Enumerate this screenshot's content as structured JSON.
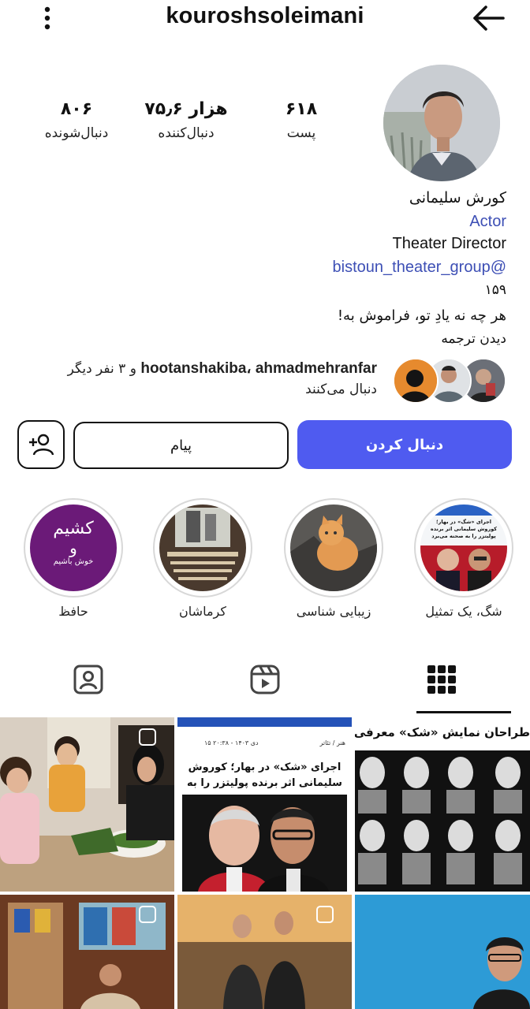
{
  "header": {
    "username": "kouroshsoleimani",
    "menu_icon": "vertical-dots-icon",
    "back_icon": "arrow-right-icon"
  },
  "stats": {
    "posts_value": "۶۱۸",
    "posts_label": "پست",
    "followers_value": "۷۵٫۶ هزار",
    "followers_label": "دنبال‌کننده",
    "following_value": "۸۰۶",
    "following_label": "دنبال‌شونده"
  },
  "bio": {
    "name": "کورش سلیمانی",
    "category": "Actor",
    "line1": "Theater Director",
    "mention": "bistoun_theater_group@",
    "number": "۱۵۹",
    "quote": "هر چه نه یادِ تو، فراموش به!",
    "translate": "دیدن ترجمه"
  },
  "followed_by": {
    "names": "hootanshakiba، ahmadmehranfar",
    "others": " و ۳ نفر دیگر",
    "suffix": "دنبال می‌کنند"
  },
  "actions": {
    "follow": "دنبال کردن",
    "message": "پیام",
    "add_user_icon": "add-person-icon"
  },
  "highlights": [
    {
      "label": "شگ، یک تمثیل"
    },
    {
      "label": "زیبایی شناسی"
    },
    {
      "label": "کرماشان"
    },
    {
      "label": "حافظ"
    }
  ],
  "highlight_text": {
    "hafez_l1": "کشیم",
    "hafez_l2": "و",
    "hafez_l3": "خوش باشیم",
    "news_headline": "اجرای «شگ» در بهار؛ کوروش سلیمانی اثر برنده پولیتزر را به صحنه می‌برد"
  },
  "tabs": [
    {
      "name": "grid",
      "icon": "grid-icon",
      "active": true
    },
    {
      "name": "reels",
      "icon": "reels-icon",
      "active": false
    },
    {
      "name": "tagged",
      "icon": "tagged-person-icon",
      "active": false
    }
  ],
  "grid_text": {
    "post2_date": "۱۵ دی ۱۴۰۳ - ۲۰:۳۸",
    "post2_crumb": "هنر / تئاتر",
    "post2_headline": "اجرای «شک» در بهار؛ کوروش سلیمانی اثر برنده پولیتزر را به صحنه می‌برد",
    "post3_headline": "طراحان نمایش «شک» معرفی شدند"
  },
  "colors": {
    "accent": "#4f5bf0",
    "link": "#3d4fb5",
    "hafez_purple": "#6b1a78"
  }
}
